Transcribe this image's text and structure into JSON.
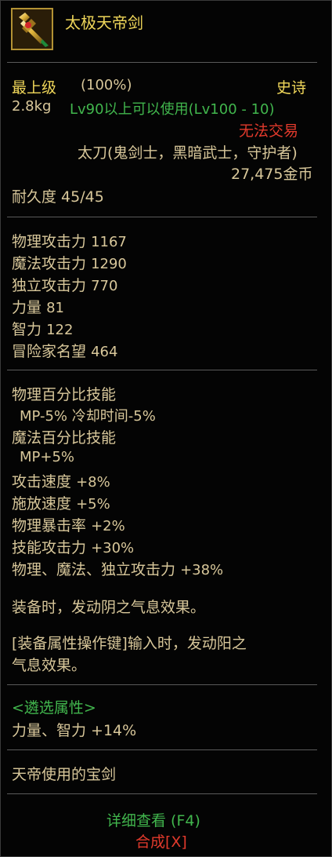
{
  "item": {
    "name": "太极天帝剑",
    "rarity": "史诗",
    "grade": "最上级",
    "grade_percent": "(100%)",
    "weight": "2.8kg",
    "level_req": "Lv90以上可以使用(Lv100 - 10)",
    "trade": "无法交易",
    "type": "太刀(鬼剑士，黑暗武士，守护者)",
    "price": "27,475金币",
    "durability": "耐久度 45/45"
  },
  "stats": [
    {
      "label": "物理攻击力",
      "value": "1167"
    },
    {
      "label": "魔法攻击力",
      "value": "1290"
    },
    {
      "label": "独立攻击力",
      "value": "770"
    },
    {
      "label": "力量",
      "value": "81"
    },
    {
      "label": "智力",
      "value": "122"
    },
    {
      "label": "冒险家名望",
      "value": "464"
    }
  ],
  "skills": {
    "phys_title": "物理百分比技能",
    "phys_detail": "MP-5% 冷却时间-5%",
    "mag_title": "魔法百分比技能",
    "mag_detail": "MP+5%",
    "bonuses": [
      {
        "label": "攻击速度",
        "value": "+8%"
      },
      {
        "label": "施放速度",
        "value": "+5%"
      },
      {
        "label": "物理暴击率",
        "value": "+2%"
      },
      {
        "label": "技能攻击力",
        "value": "+30%"
      },
      {
        "label": "物理、魔法、独立攻击力",
        "value": "+38%"
      }
    ]
  },
  "effects": {
    "equip_effect": "装备时，发动阴之气息效果。",
    "key_effect_line1": "[装备属性操作键]输入时，发动阳之",
    "key_effect_line2": "气息效果。"
  },
  "selected_attr": {
    "title": "<遴选属性>",
    "detail": "力量、智力 +14%"
  },
  "flavor": "天帝使用的宝剑",
  "actions": {
    "details": "详细查看 (F4)",
    "synth": "合成[X]"
  },
  "colors": {
    "text_gold": "#d8c79a",
    "rarity_gold": "#f0d75a",
    "green": "#41b64d",
    "red": "#e23a2c",
    "pink": "#ff6b82",
    "icon_border": "#b39234"
  },
  "icons": {
    "item_icon": "sword-icon"
  }
}
